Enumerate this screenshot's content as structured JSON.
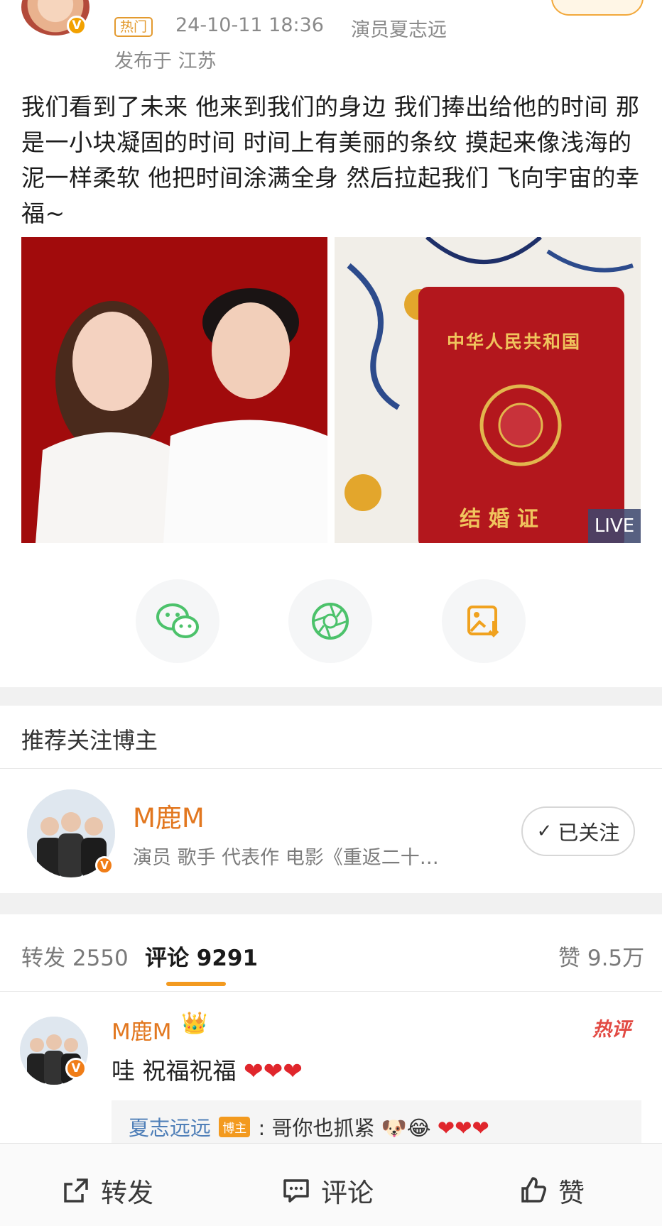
{
  "post": {
    "badge": "热门",
    "timestamp": "24-10-11 18:36",
    "source": "演员夏志远",
    "location": "发布于 江苏",
    "text": "我们看到了未来 他来到我们的身边 我们捧出给他的时间 那是一小块凝固的时间 时间上有美丽的条纹 摸起来像浅海的泥一样柔软 他把时间涂满全身 然后拉起我们 飞向宇宙的幸福~",
    "photo_left_alt": "couple wedding photo on red background",
    "photo_right_text_top": "中华人民共和国",
    "photo_right_text_bottom": "结 婚 证",
    "live_label": "LIVE"
  },
  "share": {
    "wechat_icon": "wechat-icon",
    "moments_icon": "moments-icon",
    "save_icon": "save-image-icon"
  },
  "recommend": {
    "title": "推荐关注博主",
    "name": "M鹿M",
    "desc": "演员 歌手 代表作 电影《重返二十…",
    "followed_label": "已关注"
  },
  "tabs": {
    "repost": "转发 2550",
    "comment": "评论 9291",
    "like": "赞 9.5万"
  },
  "comment": {
    "name": "M鹿M",
    "text": "哇 祝福祝福",
    "hot_label": "热评",
    "reply_name": "夏志远远",
    "reply_tag": "博主",
    "reply_text": ": 哥你也抓紧"
  },
  "bottom_bar": {
    "repost": "转发",
    "comment": "评论",
    "like": "赞"
  },
  "colors": {
    "accent_orange": "#f39a1f",
    "name_orange": "#e2771f",
    "hot_red": "#e24a43",
    "heart_red": "#e0262c"
  }
}
